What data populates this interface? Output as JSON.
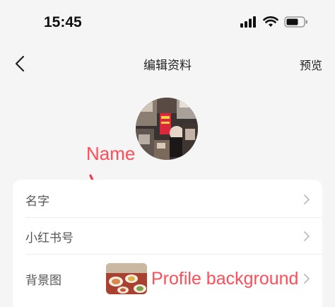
{
  "status_bar": {
    "time": "15:45"
  },
  "nav": {
    "title": "编辑资料",
    "preview": "预览"
  },
  "annotations": {
    "name": "Name",
    "profile_background": "Profile background",
    "color": "#ff4d5a"
  },
  "fields": [
    {
      "label": "名字"
    },
    {
      "label": "小红书号"
    },
    {
      "label": "背景图"
    }
  ],
  "icons": {
    "back": "chevron-left-icon",
    "row_chevron": "chevron-right-icon",
    "signal": "cellular-signal-icon",
    "wifi": "wifi-icon",
    "battery": "battery-icon"
  }
}
